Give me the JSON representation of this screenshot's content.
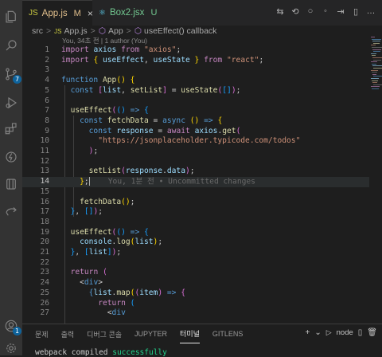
{
  "activity_bar": {
    "items": [
      "files-icon",
      "search-icon",
      "source-control-icon",
      "run-debug-icon",
      "extensions-icon",
      "github-actions-icon",
      "database-icon",
      "remote-explorer-icon"
    ],
    "source_control_badge": "7",
    "accounts_badge": "1"
  },
  "tabs": [
    {
      "label": "App.js",
      "status": "M",
      "file_icon": "JS",
      "color": "#e2c08d",
      "active": true
    },
    {
      "label": "Box2.jsx",
      "status": "U",
      "file_icon": "⚛",
      "color": "#73c991",
      "active": false
    }
  ],
  "tab_actions": [
    "⇆",
    "⟲",
    "○",
    "◦",
    "⇥",
    "▯",
    "…"
  ],
  "breadcrumb": {
    "parts": [
      "src",
      "App.js",
      "App",
      "useEffect() callback"
    ],
    "separator": ">"
  },
  "codelens": "You, 34초 전 | 1 author (You)",
  "editor": {
    "current_line": 14,
    "inline_blame": "You, 1분 전 • Uncommitted changes",
    "lines": [
      {
        "n": "1",
        "html": "<span class='c'>import</span> <span class='v'>axios</span> <span class='c'>from</span> <span class='s'>\"axios\"</span><span class='p'>;</span>"
      },
      {
        "n": "2",
        "html": "<span class='c'>import</span> <span class='b1'>{</span> <span class='v'>useEffect</span><span class='p'>,</span> <span class='v'>useState</span> <span class='b1'>}</span> <span class='c'>from</span> <span class='s'>\"react\"</span><span class='p'>;</span>"
      },
      {
        "n": "3",
        "html": ""
      },
      {
        "n": "4",
        "html": "<span class='k'>function</span> <span class='f'>App</span><span class='b1'>()</span> <span class='b1'>{</span>"
      },
      {
        "n": "5",
        "html": "  <span class='k'>const</span> <span class='b2'>[</span><span class='v'>list</span><span class='p'>,</span> <span class='f'>setList</span><span class='b2'>]</span> <span class='p'>=</span> <span class='f'>useState</span><span class='b2'>(</span><span class='b3'>[]</span><span class='b2'>)</span><span class='p'>;</span>"
      },
      {
        "n": "6",
        "html": ""
      },
      {
        "n": "7",
        "html": "  <span class='f'>useEffect</span><span class='b2'>(</span><span class='b3'>()</span> <span class='k'>=&gt;</span> <span class='b3'>{</span>"
      },
      {
        "n": "8",
        "html": "    <span class='k'>const</span> <span class='f'>fetchData</span> <span class='p'>=</span> <span class='k'>async</span> <span class='b1'>()</span> <span class='k'>=&gt;</span> <span class='b1'>{</span>"
      },
      {
        "n": "9",
        "html": "      <span class='k'>const</span> <span class='v'>response</span> <span class='p'>=</span> <span class='c'>await</span> <span class='v'>axios</span><span class='p'>.</span><span class='f'>get</span><span class='b2'>(</span>"
      },
      {
        "n": "10",
        "html": "        <span class='s'>\"https://jsonplaceholder.typicode.com/todos\"</span>"
      },
      {
        "n": "11",
        "html": "      <span class='b2'>)</span><span class='p'>;</span>"
      },
      {
        "n": "12",
        "html": ""
      },
      {
        "n": "13",
        "html": "      <span class='f'>setList</span><span class='b2'>(</span><span class='v'>response</span><span class='p'>.</span><span class='v'>data</span><span class='b2'>)</span><span class='p'>;</span>"
      },
      {
        "n": "14",
        "html": "    <span class='b1'>}</span><span class='p'>;</span>"
      },
      {
        "n": "15",
        "html": ""
      },
      {
        "n": "16",
        "html": "    <span class='f'>fetchData</span><span class='b1'>()</span><span class='p'>;</span>"
      },
      {
        "n": "17",
        "html": "  <span class='b3'>}</span><span class='p'>,</span> <span class='b3'>[]</span><span class='b2'>)</span><span class='p'>;</span>"
      },
      {
        "n": "18",
        "html": ""
      },
      {
        "n": "19",
        "html": "  <span class='f'>useEffect</span><span class='b2'>(</span><span class='b3'>()</span> <span class='k'>=&gt;</span> <span class='b3'>{</span>"
      },
      {
        "n": "20",
        "html": "    <span class='v'>console</span><span class='p'>.</span><span class='f'>log</span><span class='b1'>(</span><span class='v'>list</span><span class='b1'>)</span><span class='p'>;</span>"
      },
      {
        "n": "21",
        "html": "  <span class='b3'>}</span><span class='p'>,</span> <span class='b3'>[</span><span class='v'>list</span><span class='b3'>]</span><span class='b2'>)</span><span class='p'>;</span>"
      },
      {
        "n": "22",
        "html": ""
      },
      {
        "n": "23",
        "html": "  <span class='c'>return</span> <span class='b2'>(</span>"
      },
      {
        "n": "24",
        "html": "    <span class='p'>&lt;</span><span class='k'>div</span><span class='p'>&gt;</span>"
      },
      {
        "n": "25",
        "html": "      <span class='k'>{</span><span class='v'>list</span><span class='p'>.</span><span class='f'>map</span><span class='b1'>(</span><span class='b2'>(</span><span class='v'>item</span><span class='b2'>)</span> <span class='k'>=&gt;</span> <span class='b2'>{</span>"
      },
      {
        "n": "26",
        "html": "        <span class='c'>return</span> <span class='b3'>(</span>"
      },
      {
        "n": "27",
        "html": "          <span class='p'>&lt;</span><span class='k'>div</span>"
      }
    ]
  },
  "panel": {
    "tabs": [
      "문제",
      "출력",
      "디버그 콘솔",
      "JUPYTER",
      "터미널",
      "GITLENS"
    ],
    "active_tab": "터미널",
    "terminal_name": "node",
    "actions": [
      "+",
      "⌄",
      "▯",
      "🗑",
      "⋯"
    ],
    "terminal_text": "webpack compiled ",
    "terminal_status": "successfully"
  }
}
